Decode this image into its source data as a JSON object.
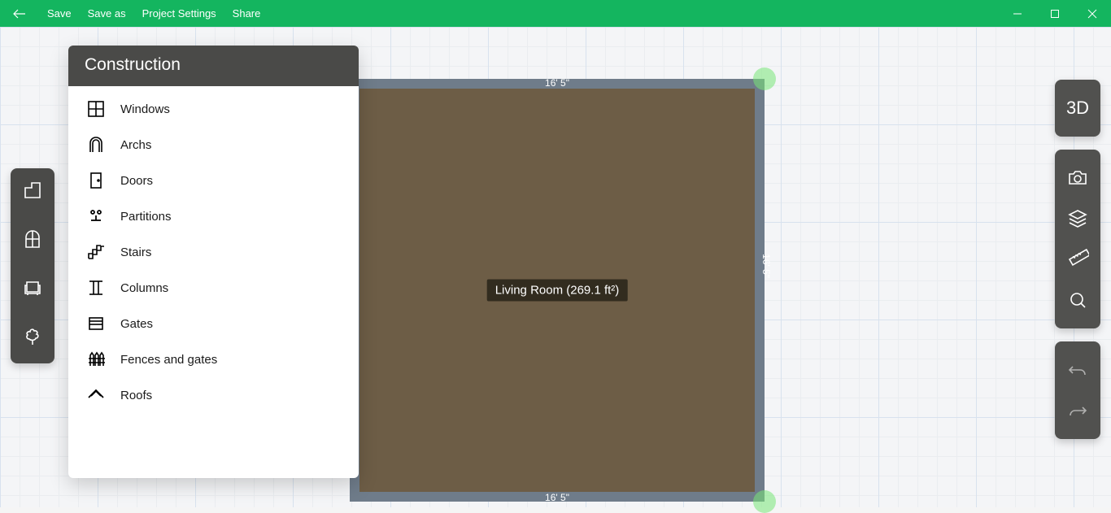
{
  "topbar": {
    "menu": {
      "save": "Save",
      "saveas": "Save as",
      "settings": "Project Settings",
      "share": "Share"
    }
  },
  "panel": {
    "title": "Construction",
    "items": {
      "windows": "Windows",
      "archs": "Archs",
      "doors": "Doors",
      "partitions": "Partitions",
      "stairs": "Stairs",
      "columns": "Columns",
      "gates": "Gates",
      "fences": "Fences and gates",
      "roofs": "Roofs"
    }
  },
  "room": {
    "label": "Living Room (269.1 ft²)",
    "dim_top": "16' 5\"",
    "dim_bottom": "16' 5\"",
    "dim_right": "16' 5\""
  },
  "right": {
    "mode3d": "3D"
  }
}
